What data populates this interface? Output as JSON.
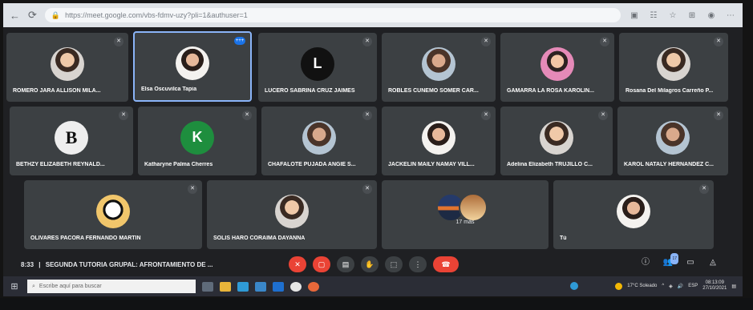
{
  "browser": {
    "url": "https://meet.google.com/vbs-fdmv-uzy?pli=1&authuser=1"
  },
  "participants": [
    {
      "name": "ROMERO JARA ALLISON MILA..."
    },
    {
      "name": "Elsa Oscuvilca Tapia",
      "badge": "+++"
    },
    {
      "name": "LUCERO SABRINA CRUZ JAIMES",
      "initial": "L"
    },
    {
      "name": "ROBLES CUNEMO SOMER CAR..."
    },
    {
      "name": "GAMARRA LA ROSA KAROLIN..."
    },
    {
      "name": "Rosana Del Milagros Carreño P..."
    },
    {
      "name": "BETHZY ELIZABETH REYNALD...",
      "initial": "B"
    },
    {
      "name": "Katharyne Palma Cherres",
      "initial": "K"
    },
    {
      "name": "CHAFALOTE PUJADA ANGIE S..."
    },
    {
      "name": "JACKELIN MAILY NAMAY VILL..."
    },
    {
      "name": "Adelina Elizabeth TRUJILLO C..."
    },
    {
      "name": "KAROL NATALY HERNÁNDEZ C..."
    },
    {
      "name": "OLIVARES PACORA FERNANDO MARTÍN"
    },
    {
      "name": "SOLIS HARO CORAIMA DAYANNA"
    },
    {
      "name": "17 más"
    },
    {
      "name": "Tú"
    }
  ],
  "meeting": {
    "time": "8:33",
    "separator": "|",
    "title": "SEGUNDA TUTORIA GRUPAL: AFRONTAMIENTO DE ..."
  },
  "controls": {
    "people_count": "17"
  },
  "taskbar": {
    "search_placeholder": "Escribe aquí para buscar",
    "weather": "17°C Soleado",
    "lang": "ESP",
    "time": "08:13:09",
    "date": "27/10/2021"
  },
  "colors": {
    "tile": "#3c4043",
    "active_border": "#8ab4f8",
    "leave": "#ea4335",
    "avatar_green": "#1e8e3e"
  }
}
